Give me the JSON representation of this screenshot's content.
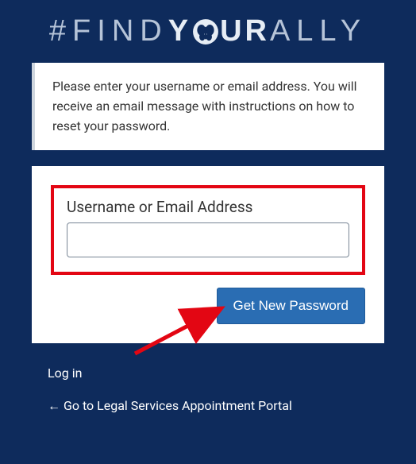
{
  "logo": {
    "hash": "#",
    "word1": "FIND",
    "word2a": "Y",
    "word2b": "UR",
    "word3": "ALLY"
  },
  "message": "Please enter your username or email address. You will receive an email message with instructions on how to reset your password.",
  "form": {
    "label": "Username or Email Address",
    "value": "",
    "submit": "Get New Password"
  },
  "links": {
    "login": "Log in",
    "back": "← Go to Legal Services Appointment Portal"
  },
  "colors": {
    "background": "#0e2b5c",
    "highlight": "#e30613",
    "button": "#2a6db3"
  }
}
